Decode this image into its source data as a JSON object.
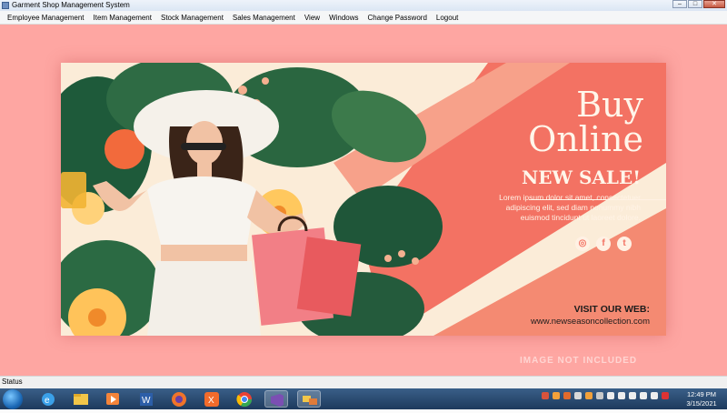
{
  "window": {
    "title": "Garment Shop Management System"
  },
  "menu": [
    "Employee Management",
    "Item Management",
    "Stock Management",
    "Sales Management",
    "View",
    "Windows",
    "Change Password",
    "Logout"
  ],
  "banner": {
    "headline_1": "Buy",
    "headline_2": "Online",
    "sale": "NEW SALE!",
    "lorem_1": "Lorem ipsum dolor sit amet, consectetuer",
    "lorem_2": "adipiscing elit, sed diam nonummy nibh",
    "lorem_3": "euismod tincidunt ut laoreet dolore.",
    "visit": "VISIT OUR WEB:",
    "url": "www.newseasoncollection.com",
    "watermark": "IMAGE NOT INCLUDED",
    "social": [
      "instagram-icon",
      "facebook-icon",
      "twitter-icon"
    ]
  },
  "status": {
    "label": "Status"
  },
  "taskbar": {
    "time": "12:49 PM",
    "date": "3/15/2021",
    "apps": [
      "ie-icon",
      "explorer-icon",
      "media-player-icon",
      "word-icon",
      "firefox-icon",
      "xampp-icon",
      "chrome-icon",
      "visual-studio-icon",
      "app-window-icon"
    ]
  },
  "colors": {
    "background": "#fea6a2",
    "banner_accent": "#f37263",
    "banner_cream": "#fbecd8"
  }
}
